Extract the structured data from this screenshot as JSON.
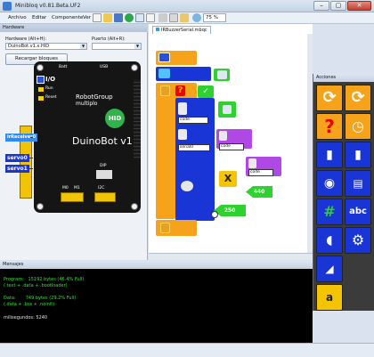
{
  "window": {
    "title": "Minibloq v0.81.Beta.UF2"
  },
  "menu": [
    "Archivo",
    "Editar",
    "Componente",
    "Ver"
  ],
  "toolbar": {
    "zoom": "75 %"
  },
  "hardware_panel": {
    "header": "Hardware",
    "hardware_label": "Hardware (Alt+H):",
    "hardware_value": "DuinoBot.v1.x.HID",
    "port_label": "Puerto (Alt+R):",
    "port_value": "",
    "reload_button": "Recargar bloques",
    "board": {
      "brand_line1": "RobotGroup",
      "brand_line2": "multiplo",
      "name": "DuinoBot v1",
      "badge": "HID",
      "io_label": "I/O",
      "run_label": "Run",
      "reset_label": "Reset",
      "dip_label": "DIP",
      "m0_label": "M0",
      "m1_label": "M1",
      "i2c_label": "I2C",
      "usb_label": "USB",
      "batt_label": "Batt"
    },
    "wires": [
      "irReceiver0",
      "servo0",
      "servo1"
    ]
  },
  "editor": {
    "tab": "IRBuzzerSerial.mbqc",
    "chips": [
      "code",
      "code",
      "serial0",
      "code"
    ],
    "numbers": [
      "440",
      "250"
    ]
  },
  "actions": {
    "header": "Acciones"
  },
  "messages": {
    "header": "Mensajes",
    "lines": [
      "Program:   15192 bytes (46.4% Full)",
      "(.text + .data + .bootloader)",
      "",
      "Data:       749 bytes (29.2% Full)",
      "(.data + .bss + .noinit)",
      "",
      "milisegundos: 5240"
    ]
  },
  "colors": {
    "orange": "#f7a21b",
    "blue": "#1a35d6",
    "green": "#2fd12f",
    "purple": "#b048e6",
    "teal": "#1aa98f",
    "yellow": "#f5c400"
  }
}
